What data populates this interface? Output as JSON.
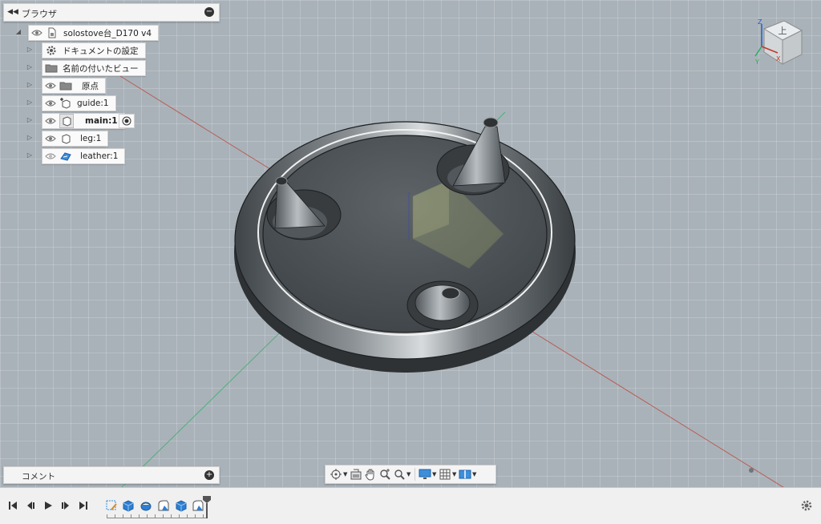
{
  "browser": {
    "title": "ブラウザ",
    "root": {
      "label": "solostove台_D170 v4"
    },
    "items": [
      {
        "label": "ドキュメントの設定",
        "icon": "gear-icon",
        "visible_toggle": false
      },
      {
        "label": "名前の付いたビュー",
        "icon": "folder-icon",
        "visible_toggle": false
      },
      {
        "label": "原点",
        "icon": "folder-icon",
        "visible_toggle": true
      },
      {
        "label": "guide:1",
        "icon": "component-link-icon",
        "visible_toggle": true
      },
      {
        "label": "main:1",
        "icon": "component-icon",
        "visible_toggle": true,
        "active": true
      },
      {
        "label": "leg:1",
        "icon": "component-icon",
        "visible_toggle": true
      },
      {
        "label": "leather:1",
        "icon": "component-decal-icon",
        "visible_toggle": true
      }
    ]
  },
  "comments": {
    "title": "コメント"
  },
  "viewcube": {
    "face_label": "上",
    "axes": [
      "Z",
      "X",
      "Y"
    ]
  },
  "nav_toolbar": {
    "tools": [
      "orbit-icon",
      "look-at-icon",
      "pan-icon",
      "zoom-window-icon",
      "zoom-icon",
      "display-settings-icon",
      "grid-settings-icon",
      "viewports-icon"
    ]
  },
  "timeline": {
    "controls": [
      "go-to-start-icon",
      "step-back-icon",
      "play-icon",
      "step-forward-icon",
      "go-to-end-icon"
    ],
    "features": [
      "sketch-icon",
      "extrude-icon",
      "revolve-icon",
      "fillet-icon",
      "extrude-icon",
      "fillet-icon"
    ]
  },
  "colors": {
    "viewport_bg": "#a9b2b9",
    "panel_bg": "#f4f4f4",
    "accent_blue": "#1e7fd6",
    "axis_red": "#c0392b",
    "axis_green": "#27ae60"
  }
}
